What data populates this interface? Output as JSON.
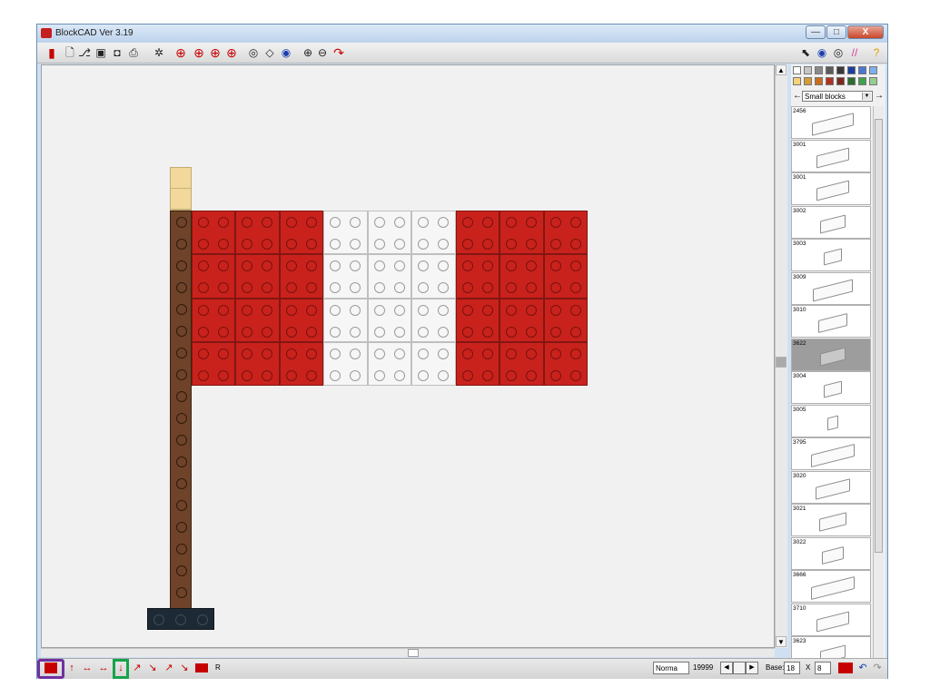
{
  "window": {
    "title": "BlockCAD Ver 3.19",
    "minimize": "—",
    "maximize": "□",
    "close": "X"
  },
  "toolbar": {
    "icons": [
      "logo-icon",
      "new-icon",
      "open-icon",
      "save-icon",
      "camera-icon",
      "print-icon",
      "settings-icon",
      "rotate-left-icon",
      "rotate-down-icon",
      "rotate-up-icon",
      "rotate-right-icon",
      "center-icon",
      "view-icon",
      "eye-icon",
      "zoom-in-icon",
      "zoom-out-icon",
      "undo-icon"
    ],
    "right_icons": [
      "pointer-icon",
      "eye-icon",
      "view-icon",
      "rainbow-icon",
      "help-icon"
    ]
  },
  "palette": {
    "colors_row1": [
      "#ffffff",
      "#c6c6c6",
      "#8a8a8a",
      "#5c5c5c",
      "#393939",
      "#1a3f9c",
      "#4b78cf",
      "#7eb0ee"
    ],
    "colors_row2": [
      "#f5d27a",
      "#d59b37",
      "#c96d22",
      "#b0331f",
      "#7a2a1c",
      "#2d6c2f",
      "#3fa24c",
      "#96ce8f"
    ],
    "set_label": "Small blocks",
    "parts": [
      {
        "num": "2456",
        "w": 44,
        "selected": false
      },
      {
        "num": "3001",
        "w": 34,
        "selected": false
      },
      {
        "num": "3001",
        "w": 34,
        "selected": false
      },
      {
        "num": "3002",
        "w": 26,
        "selected": false
      },
      {
        "num": "3003",
        "w": 18,
        "selected": false
      },
      {
        "num": "3009",
        "w": 42,
        "selected": false
      },
      {
        "num": "3010",
        "w": 30,
        "selected": false
      },
      {
        "num": "3622",
        "w": 26,
        "selected": true
      },
      {
        "num": "3004",
        "w": 18,
        "selected": false
      },
      {
        "num": "3005",
        "w": 10,
        "selected": false
      },
      {
        "num": "3795",
        "w": 46,
        "selected": false
      },
      {
        "num": "3020",
        "w": 36,
        "selected": false
      },
      {
        "num": "3021",
        "w": 28,
        "selected": false
      },
      {
        "num": "3022",
        "w": 22,
        "selected": false
      },
      {
        "num": "3666",
        "w": 46,
        "selected": false
      },
      {
        "num": "3710",
        "w": 34,
        "selected": false
      },
      {
        "num": "3623",
        "w": 26,
        "selected": false
      }
    ]
  },
  "statusbar": {
    "rotate_label": "R",
    "mode": "Norma",
    "counter": "19999",
    "base_label": "Base:",
    "base_x": "18",
    "times": "X",
    "base_y": "8"
  },
  "model": {
    "flag_columns": [
      "r",
      "r",
      "r",
      "w",
      "w",
      "w",
      "r",
      "r",
      "r"
    ],
    "flag_rows": 4
  }
}
